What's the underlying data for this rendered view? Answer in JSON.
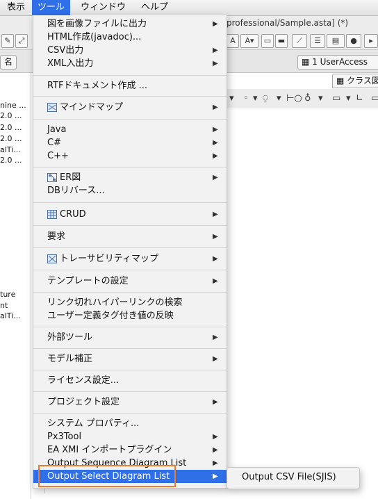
{
  "menubar": {
    "items": [
      "表示",
      "ツール",
      "ウィンドウ",
      "ヘルプ"
    ],
    "active_color": "#2f6fe8"
  },
  "background": {
    "window_title": "professional/Sample.asta] (*)",
    "tab_left": "名",
    "tab_user_access": "1 UserAccess",
    "tab_class": "クラス図",
    "left_pane_lines": [
      "nine ...",
      "2.0 ...",
      "2.0 ...",
      "2.0 ...",
      "alTi...",
      "2.0 ...",
      "ture",
      "nt",
      "alTi..."
    ]
  },
  "tools_menu": {
    "items": [
      {
        "label": "図を画像ファイルに出力",
        "submenu": true
      },
      {
        "label": "HTML作成(javadoc)...",
        "submenu": false
      },
      {
        "label": "CSV出力",
        "submenu": true
      },
      {
        "label": "XML入出力",
        "submenu": true
      },
      {
        "label": "RTFドキュメント作成 ...",
        "submenu": false
      },
      {
        "label": "マインドマップ",
        "submenu": true,
        "icon": "mindmap-icon"
      },
      {
        "label": "Java",
        "submenu": true
      },
      {
        "label": "C#",
        "submenu": true
      },
      {
        "label": "C++",
        "submenu": true
      },
      {
        "label": "ER図",
        "submenu": true,
        "icon": "er-diagram-icon"
      },
      {
        "label": "DBリバース...",
        "submenu": false
      },
      {
        "label": "CRUD",
        "submenu": true,
        "icon": "crud-icon"
      },
      {
        "label": "要求",
        "submenu": true
      },
      {
        "label": "トレーサビリティマップ",
        "submenu": true,
        "icon": "traceability-map-icon"
      },
      {
        "label": "テンプレートの設定",
        "submenu": true
      },
      {
        "label": "リンク切れハイパーリンクの検索",
        "submenu": false
      },
      {
        "label": "ユーザー定義タグ付き値の反映",
        "submenu": false
      },
      {
        "label": "外部ツール",
        "submenu": true
      },
      {
        "label": "モデル補正",
        "submenu": true
      },
      {
        "label": "ライセンス設定...",
        "submenu": false
      },
      {
        "label": "プロジェクト設定",
        "submenu": true
      },
      {
        "label": "システム プロパティ...",
        "submenu": false
      },
      {
        "label": "Px3Tool",
        "submenu": true
      },
      {
        "label": "EA XMI インポートプラグイン",
        "submenu": true
      },
      {
        "label": "Output Sequence Diagram List",
        "submenu": true
      },
      {
        "label": "Output Select Diagram List",
        "submenu": true,
        "highlighted": true
      }
    ]
  },
  "submenu": {
    "items": [
      {
        "label": "Output CSV File(SJIS)"
      }
    ]
  },
  "annotation": {
    "color": "#f07a30"
  }
}
